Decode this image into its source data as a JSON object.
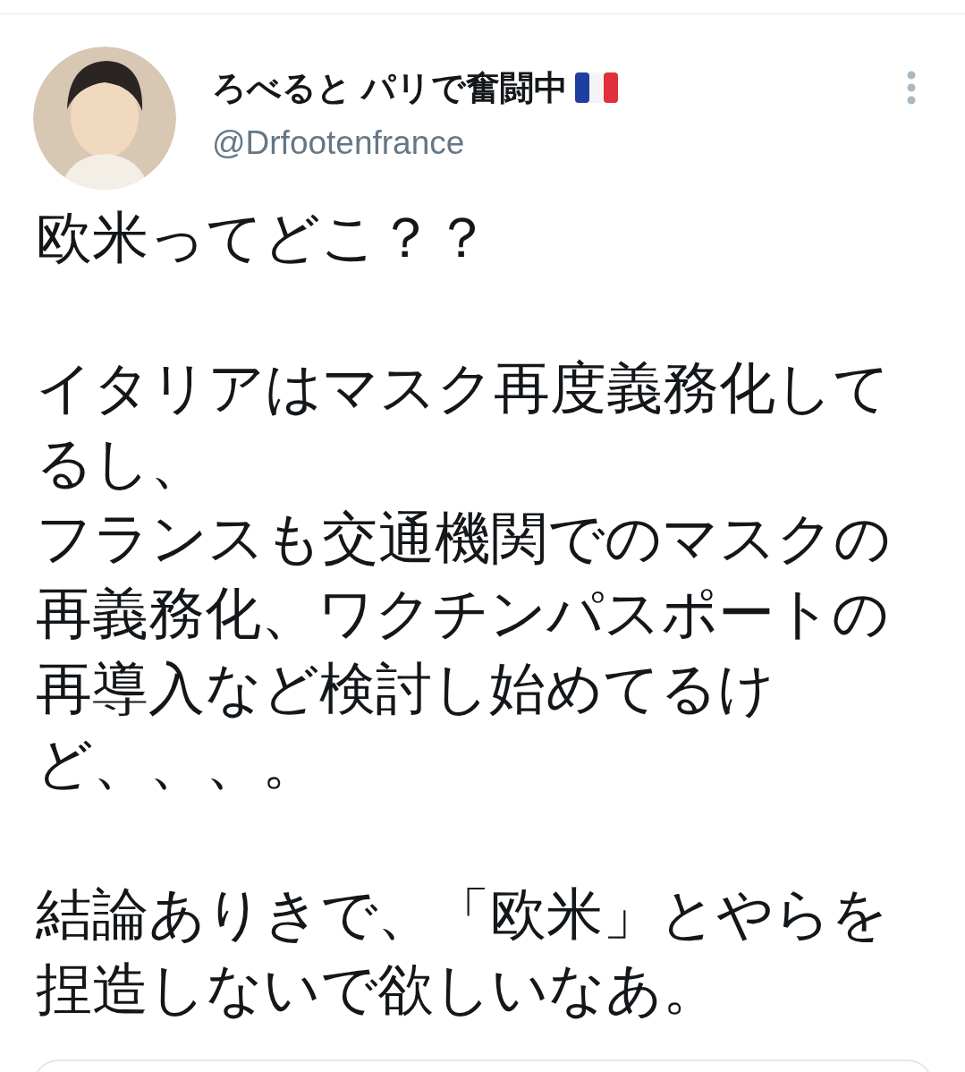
{
  "author": {
    "name": "ろべると パリで奮闘中",
    "handle": "@Drfootenfrance"
  },
  "tweet": {
    "paragraphs": [
      {
        "lines": [
          "欧米ってどこ？？"
        ]
      },
      {
        "lines": [
          "イタリアはマスク再度義務化してるし、",
          "フランスも交通機関でのマスクの再義務化、ワクチンパスポートの再導入など検討し始めてるけど、、、。"
        ]
      },
      {
        "lines": [
          "結論ありきで、「欧米」とやらを捏造しないで欲しいなあ。"
        ]
      }
    ]
  }
}
